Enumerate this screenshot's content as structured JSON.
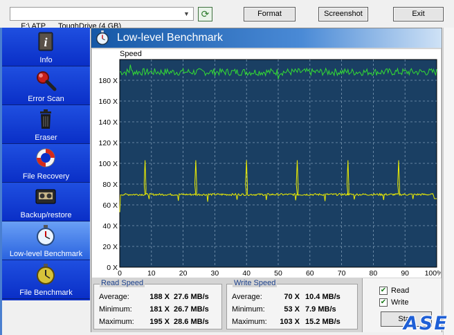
{
  "toolbar": {
    "drive": "F:\\ ATP      ToughDrive (4 GB)",
    "format_label": "Format",
    "screenshot_label": "Screenshot",
    "exit_label": "Exit"
  },
  "sidebar": {
    "items": [
      {
        "label": "Info",
        "icon": "info-icon"
      },
      {
        "label": "Error Scan",
        "icon": "magnifier-icon"
      },
      {
        "label": "Eraser",
        "icon": "trash-icon"
      },
      {
        "label": "File Recovery",
        "icon": "lifebuoy-icon"
      },
      {
        "label": "Backup/restore",
        "icon": "tape-icon"
      },
      {
        "label": "Low-level Benchmark",
        "icon": "stopwatch-icon",
        "active": true
      },
      {
        "label": "File Benchmark",
        "icon": "stopwatch-gold-icon"
      }
    ]
  },
  "panel": {
    "title": "Low-level Benchmark"
  },
  "chart_data": {
    "type": "line",
    "ylabel": "Speed",
    "ylim": [
      0,
      200
    ],
    "yticks": [
      "0 X",
      "20 X",
      "40 X",
      "60 X",
      "80 X",
      "100 X",
      "120 X",
      "140 X",
      "160 X",
      "180 X"
    ],
    "xlim": [
      0,
      100
    ],
    "xticks": [
      "0",
      "10",
      "20",
      "30",
      "40",
      "50",
      "60",
      "70",
      "80",
      "90",
      "100%"
    ],
    "grid": true,
    "colors": {
      "background": "#1a3f63",
      "read": "#33dd33",
      "write": "#f0f000",
      "grid": "#7d9ab5"
    },
    "series": [
      {
        "key": "read",
        "avg": 188,
        "min": 181,
        "max": 195
      },
      {
        "key": "write",
        "avg": 70,
        "min": 53,
        "max": 103,
        "spikes_at": [
          8,
          24,
          40,
          56,
          72,
          88
        ]
      }
    ]
  },
  "read_speed": {
    "title": "Read Speed",
    "rows": [
      {
        "k": "Average:",
        "x": "188 X",
        "mb": "27.6 MB/s"
      },
      {
        "k": "Minimum:",
        "x": "181 X",
        "mb": "26.7 MB/s"
      },
      {
        "k": "Maximum:",
        "x": "195 X",
        "mb": "28.6 MB/s"
      }
    ]
  },
  "write_speed": {
    "title": "Write Speed",
    "rows": [
      {
        "k": "Average:",
        "x": "70 X",
        "mb": "10.4 MB/s"
      },
      {
        "k": "Minimum:",
        "x": "53 X",
        "mb": "7.9 MB/s"
      },
      {
        "k": "Maximum:",
        "x": "103 X",
        "mb": "15.2 MB/s"
      }
    ]
  },
  "options": {
    "read_label": "Read",
    "write_label": "Write",
    "read_checked": true,
    "write_checked": true,
    "start_label": "Start"
  },
  "watermark": "ASE"
}
